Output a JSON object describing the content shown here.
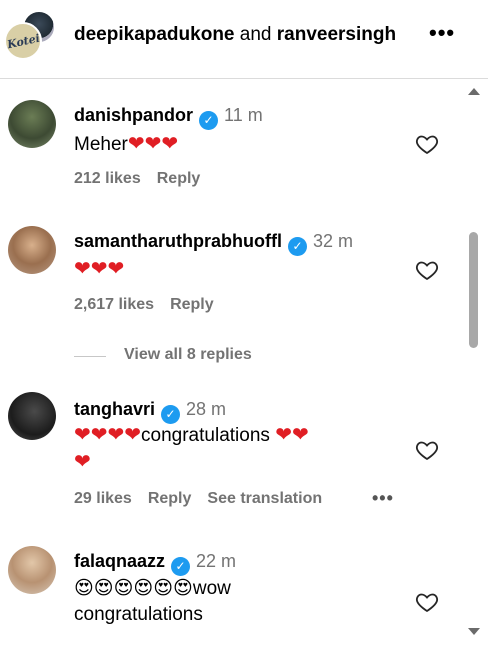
{
  "header": {
    "user1": "deepikapadukone",
    "joiner": "and",
    "user2": "ranveersingh",
    "more": "•••"
  },
  "comments": [
    {
      "username": "danishpandor",
      "time": "11 m",
      "text": "Meher",
      "likes": "212 likes",
      "reply": "Reply"
    },
    {
      "username": "samantharuthprabhuoffl",
      "time": "32 m",
      "text": "",
      "likes": "2,617 likes",
      "reply": "Reply",
      "view_replies": "View all 8 replies"
    },
    {
      "username": "tanghavri",
      "time": "28 m",
      "text": "congratulations",
      "likes": "29 likes",
      "reply": "Reply",
      "translate": "See translation",
      "more": "•••"
    },
    {
      "username": "falaqnaazz",
      "time": "22 m",
      "text_line1": "wow",
      "text_line2": "congratulations"
    }
  ],
  "icons": {
    "verified": "verified-badge-icon",
    "heart_outline": "heart-outline-icon",
    "heart_red": "red-heart-emoji",
    "heart_eyes": "heart-eyes-emoji"
  },
  "colors": {
    "verified": "#1d9bf0",
    "muted": "#737373",
    "heart": "#e01e24"
  }
}
